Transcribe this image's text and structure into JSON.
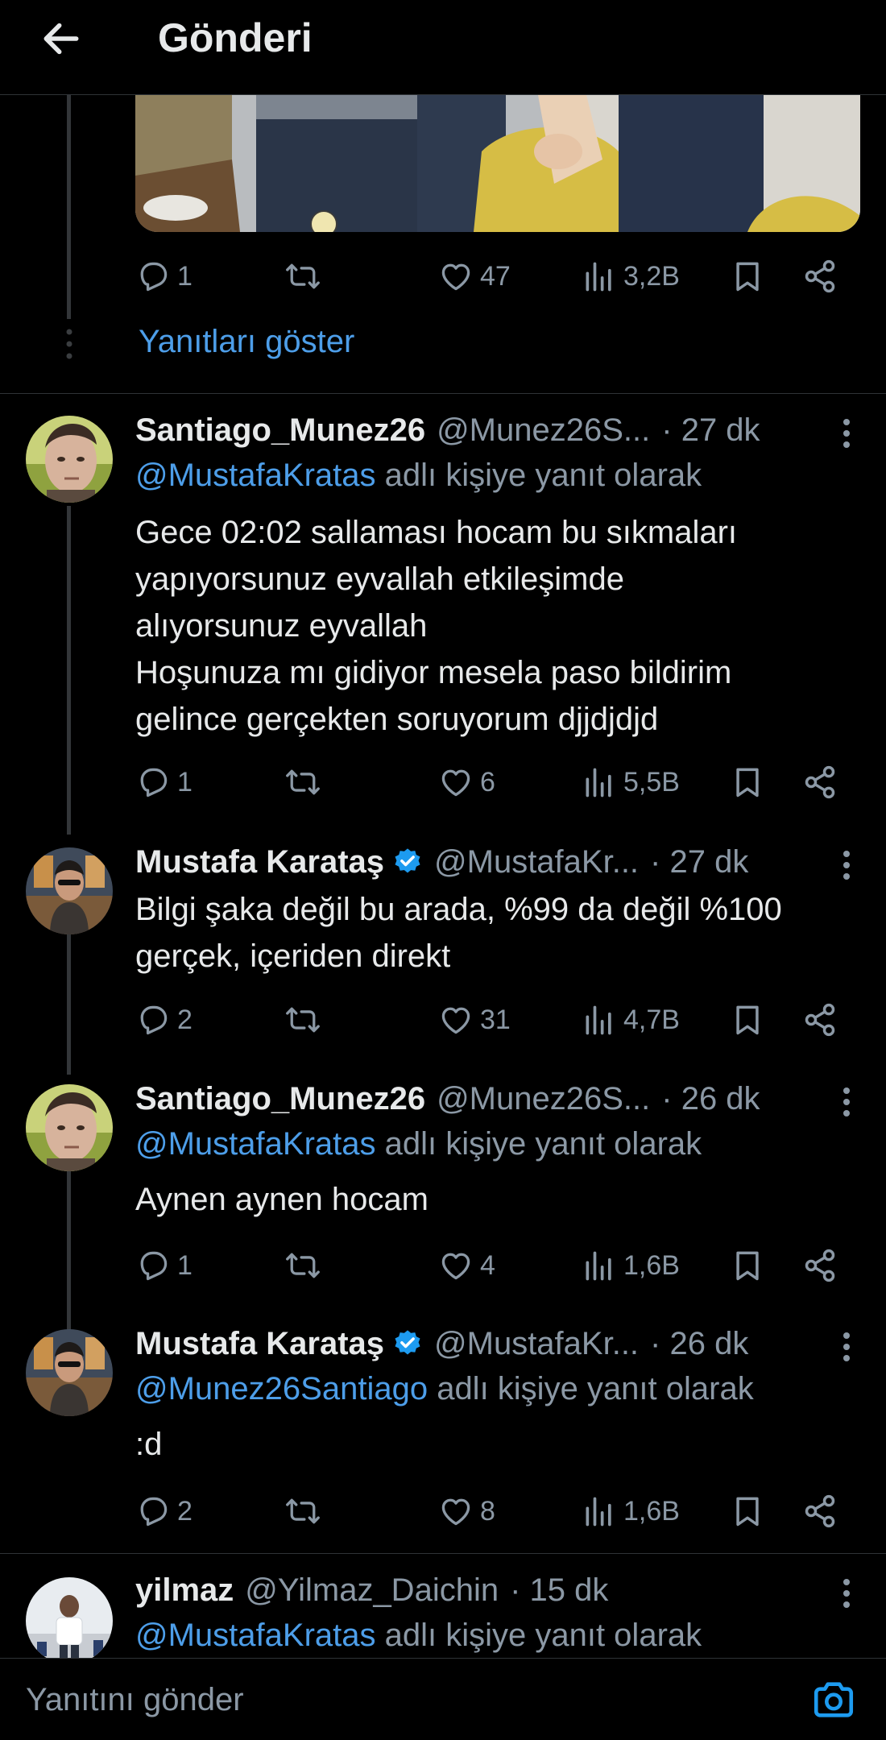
{
  "header": {
    "title": "Gönderi"
  },
  "top_post": {
    "actions": {
      "replies": "1",
      "retweets": "",
      "likes": "47",
      "views": "3,2B"
    },
    "show_replies": "Yanıtları göster"
  },
  "tweets": [
    {
      "name": "Santiago_Munez26",
      "handle": "@Munez26S...",
      "time": "· 27 dk",
      "verified": false,
      "reply_mention": "@MustafaKratas",
      "reply_suffix": " adlı kişiye yanıt olarak",
      "text": "Gece 02:02 sallaması hocam bu sıkmaları\nyapıyorsunuz eyvallah etkileşimde\nalıyorsunuz eyvallah\nHoşunuza mı gidiyor mesela paso bildirim\ngelince gerçekten soruyorum djjdjdjd",
      "actions": {
        "replies": "1",
        "retweets": "",
        "likes": "6",
        "views": "5,5B"
      }
    },
    {
      "name": "Mustafa Karataş",
      "handle": "@MustafaKr...",
      "time": "· 27 dk",
      "verified": true,
      "text": "Bilgi şaka değil bu arada, %99 da değil %100\ngerçek, içeriden direkt",
      "actions": {
        "replies": "2",
        "retweets": "",
        "likes": "31",
        "views": "4,7B"
      }
    },
    {
      "name": "Santiago_Munez26",
      "handle": "@Munez26S...",
      "time": "· 26 dk",
      "verified": false,
      "reply_mention": "@MustafaKratas",
      "reply_suffix": " adlı kişiye yanıt olarak",
      "text": "Aynen aynen hocam",
      "actions": {
        "replies": "1",
        "retweets": "",
        "likes": "4",
        "views": "1,6B"
      }
    },
    {
      "name": "Mustafa Karataş",
      "handle": "@MustafaKr...",
      "time": "· 26 dk",
      "verified": true,
      "reply_mention": "@Munez26Santiago",
      "reply_suffix": " adlı kişiye yanıt olarak",
      "text": ":d",
      "actions": {
        "replies": "2",
        "retweets": "",
        "likes": "8",
        "views": "1,6B"
      }
    },
    {
      "name": "yilmaz",
      "handle": "@Yilmaz_Daichin",
      "time": "· 15 dk",
      "verified": false,
      "reply_mention": "@MustafaKratas",
      "reply_suffix": " adlı kişiye yanıt olarak"
    }
  ],
  "composer": {
    "placeholder": "Yanıtını gönder"
  },
  "colors": {
    "background": "#000000",
    "text": "#e7e9ea",
    "muted": "#8b98a5",
    "link": "#4d9ee9",
    "verified": "#1d9bf0",
    "divider": "#2f3336"
  }
}
